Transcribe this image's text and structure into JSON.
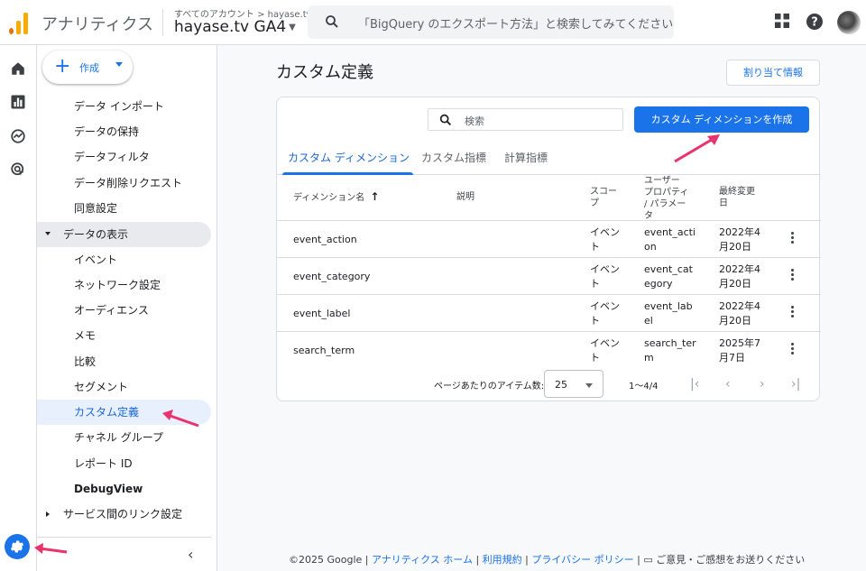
{
  "header": {
    "app_title": "アナリティクス",
    "breadcrumb": "すべてのアカウント > hayase.tv",
    "property": "hayase.tv GA4",
    "search_placeholder": "「BigQuery のエクスポート方法」と検索してみてください"
  },
  "sidebar": {
    "create_label": "作成",
    "items": [
      {
        "label": "データ インポート"
      },
      {
        "label": "データの保持"
      },
      {
        "label": "データフィルタ"
      },
      {
        "label": "データ削除リクエスト"
      },
      {
        "label": "同意設定"
      },
      {
        "label": "データの表示"
      },
      {
        "label": "イベント"
      },
      {
        "label": "ネットワーク設定"
      },
      {
        "label": "オーディエンス"
      },
      {
        "label": "メモ"
      },
      {
        "label": "比較"
      },
      {
        "label": "セグメント"
      },
      {
        "label": "カスタム定義"
      },
      {
        "label": "チャネル グループ"
      },
      {
        "label": "レポート ID"
      },
      {
        "label": "DebugView"
      },
      {
        "label": "サービス間のリンク設定"
      }
    ]
  },
  "main": {
    "title": "カスタム定義",
    "assign_button": "割り当て情報",
    "search_placeholder": "検索",
    "create_button": "カスタム ディメンションを作成",
    "tabs": [
      {
        "label": "カスタム ディメンション"
      },
      {
        "label": "カスタム指標"
      },
      {
        "label": "計算指標"
      }
    ],
    "columns": {
      "name": "ディメンション名",
      "description": "説明",
      "scope": "スコープ",
      "user_property": "ユーザー プロパティ / パラメータ",
      "last_modified": "最終変更日"
    },
    "rows": [
      {
        "name": "event_action",
        "scope": "イベント",
        "param": "event_action",
        "date": "2022年4月20日"
      },
      {
        "name": "event_category",
        "scope": "イベント",
        "param": "event_category",
        "date": "2022年4月20日"
      },
      {
        "name": "event_label",
        "scope": "イベント",
        "param": "event_label",
        "date": "2022年4月20日"
      },
      {
        "name": "search_term",
        "scope": "イベント",
        "param": "search_term",
        "date": "2025年7月7日"
      }
    ],
    "pager": {
      "label": "ページあたりのアイテム数:",
      "page_size": "25",
      "range": "1〜4/4"
    }
  },
  "footer": {
    "copyright": "©2025 Google |",
    "home": "アナリティクス ホーム",
    "terms": "利用規約",
    "privacy": "プライバシー ポリシー",
    "feedback": "ご意見・ご感想をお送りください"
  },
  "colors": {
    "accent": "#1a73e8",
    "annotation_arrow": "#e8336d"
  }
}
